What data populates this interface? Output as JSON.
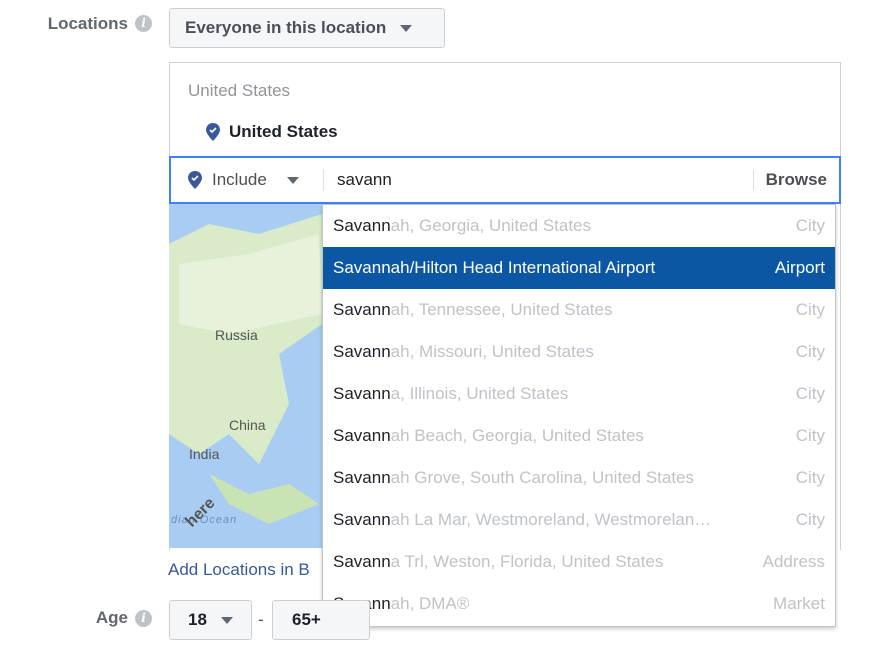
{
  "locations": {
    "label": "Locations",
    "info_icon": "info-icon",
    "audience_dropdown": "Everyone in this location",
    "selected_header": "United States",
    "selected_items": [
      "United States"
    ],
    "include_dropdown": "Include",
    "search_value": "savann",
    "browse_label": "Browse",
    "map_labels": {
      "russia": "Russia",
      "china": "China",
      "india": "India",
      "ocean": "dian Ocean",
      "logo": "here"
    },
    "add_locations_link": "Add Locations in B",
    "suggestions": [
      {
        "match": "Savann",
        "rest": "ah, Georgia, United States",
        "type": "City"
      },
      {
        "match": "Savannah/Hilton Head International Airport",
        "rest": "",
        "type": "Airport",
        "selected": true
      },
      {
        "match": "Savann",
        "rest": "ah, Tennessee, United States",
        "type": "City"
      },
      {
        "match": "Savann",
        "rest": "ah, Missouri, United States",
        "type": "City"
      },
      {
        "match": "Savann",
        "rest": "a, Illinois, United States",
        "type": "City"
      },
      {
        "match": "Savann",
        "rest": "ah Beach, Georgia, United States",
        "type": "City"
      },
      {
        "match": "Savann",
        "rest": "ah Grove, South Carolina, United States",
        "type": "City"
      },
      {
        "match": "Savann",
        "rest": "ah La Mar, Westmoreland, Westmorelan…",
        "type": "City"
      },
      {
        "match": "Savann",
        "rest": "a Trl, Weston, Florida, United States",
        "type": "Address"
      },
      {
        "match": "Savann",
        "rest": "ah, DMA®",
        "type": "Market"
      }
    ]
  },
  "age": {
    "label": "Age",
    "min": "18",
    "separator": "-",
    "max": "65+"
  },
  "colors": {
    "accent": "#4080ff",
    "selected_row": "#0b57a4",
    "link": "#365899",
    "pin": "#3b5998"
  }
}
